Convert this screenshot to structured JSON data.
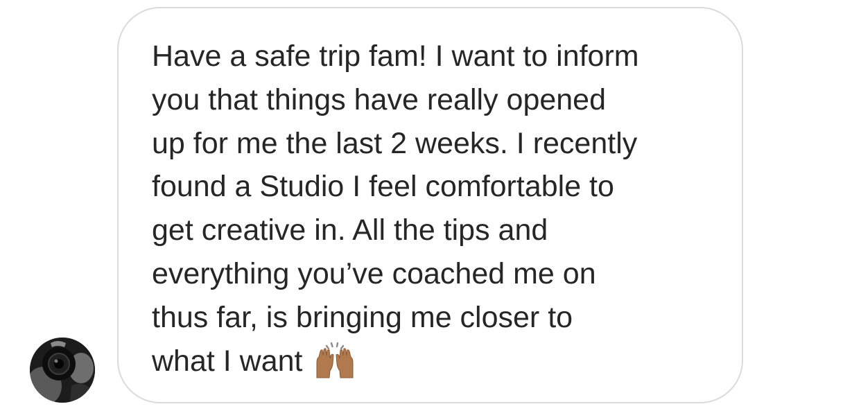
{
  "conversation": {
    "sender": {
      "avatar_icon": "camera-photographer-avatar"
    },
    "message": {
      "lines": [
        "Have a safe trip fam! I want to inform",
        "you that things have really opened",
        "up for me the last 2 weeks. I recently",
        "found a Studio I feel comfortable to",
        "get creative in. All the tips and",
        "everything you’ve coached me on",
        "thus far, is bringing me closer to",
        "what I want"
      ],
      "emoji": "raising-hands-emoji",
      "emoji_char": "🙌🏽"
    },
    "colors": {
      "bubble_border": "#dbdbdb",
      "text": "#262626",
      "background": "#ffffff"
    }
  }
}
